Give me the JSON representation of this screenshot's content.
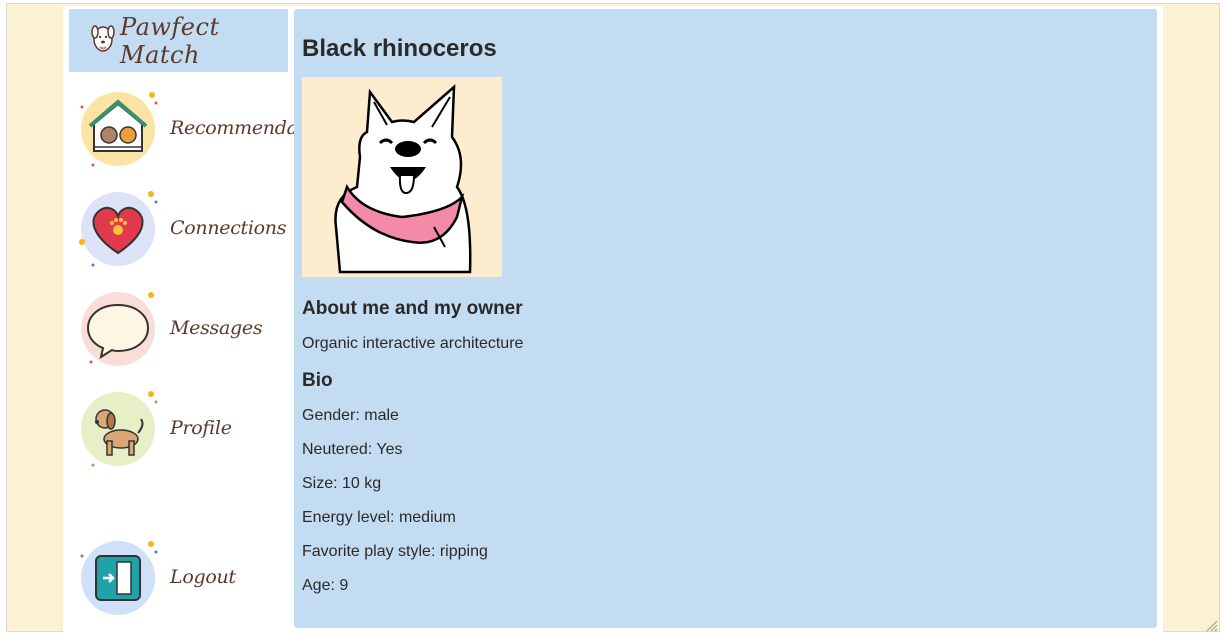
{
  "brand": {
    "name": "Pawfect Match",
    "icon": "dog-logo-icon"
  },
  "nav": [
    {
      "label": "Recommendations",
      "icon": "home-pets-icon",
      "color": "#fbe3a4"
    },
    {
      "label": "Connections",
      "icon": "heart-paw-icon",
      "color": "#dde3f7"
    },
    {
      "label": "Messages",
      "icon": "speech-bubble-icon",
      "color": "#f9ddd6"
    },
    {
      "label": "Profile",
      "icon": "dog-icon",
      "color": "#e6efc6"
    },
    {
      "label": "Logout",
      "icon": "exit-door-icon",
      "color": "#cfe0f8"
    }
  ],
  "pet": {
    "name": "Black rhinoceros",
    "about_heading": "About me and my owner",
    "about_text": "Organic interactive architecture",
    "bio_heading": "Bio",
    "bio": {
      "gender": "Gender: male",
      "neutered": "Neutered: Yes",
      "size": "Size: 10 kg",
      "energy": "Energy level: medium",
      "play": "Favorite play style: ripping",
      "age": "Age: 9"
    }
  },
  "colors": {
    "panel": "#c4dcf1",
    "background": "#fdf1d4",
    "brand_text": "#5b3a2b",
    "bandana": "#f38ba8"
  }
}
